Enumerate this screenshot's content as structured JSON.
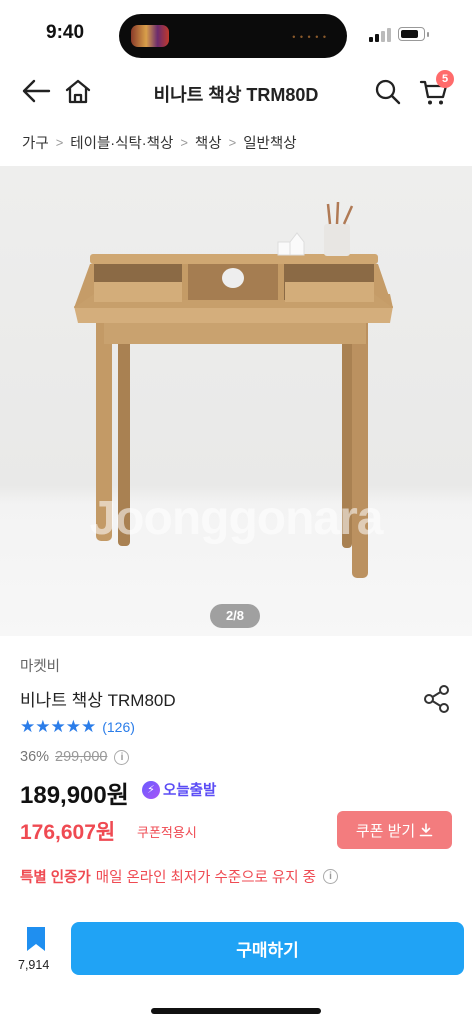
{
  "status_bar": {
    "time": "9:40"
  },
  "nav": {
    "title": "비나트 책상 TRM80D",
    "cart_count": "5"
  },
  "breadcrumb": [
    "가구",
    "테이블·식탁·책상",
    "책상",
    "일반책상"
  ],
  "gallery": {
    "watermark": "Joonggonara",
    "pager": "2/8"
  },
  "product": {
    "seller": "마켓비",
    "name": "비나트 책상 TRM80D",
    "stars": "★★★★★",
    "rating_count": "(126)",
    "discount_rate": "36%",
    "original_price": "299,000",
    "price": "189,900원",
    "delivery_badge": "오늘출발",
    "coupon_price": "176,607원",
    "coupon_label": "쿠폰적용시",
    "coupon_button": "쿠폰 받기",
    "cert_title": "특별 인증가",
    "cert_text": "매일 온라인 최저가 수준으로 유지 중"
  },
  "bottom_bar": {
    "bookmark_count": "7,914",
    "buy_label": "구매하기"
  },
  "colors": {
    "accent_blue": "#20a3f5",
    "coupon_red": "#ef4a52",
    "coupon_button": "#f37c7e",
    "delivery_purple": "#5b4cf5",
    "badge": "#ff6b6b"
  },
  "icons": [
    "back-arrow-icon",
    "home-icon",
    "search-icon",
    "cart-icon",
    "share-icon",
    "info-icon",
    "lightning-icon",
    "download-icon",
    "bookmark-icon"
  ]
}
